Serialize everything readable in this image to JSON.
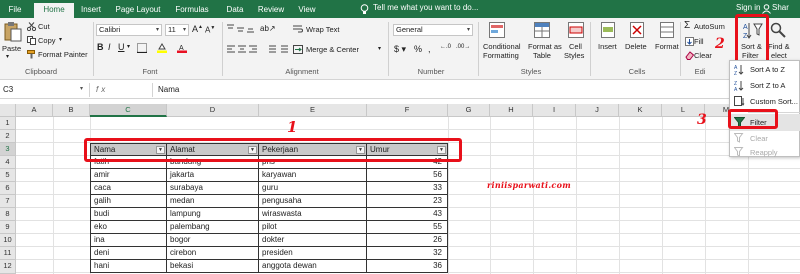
{
  "tabs": [
    "File",
    "Home",
    "Insert",
    "Page Layout",
    "Formulas",
    "Data",
    "Review",
    "View"
  ],
  "active_tab": "Home",
  "tell_me": "Tell me what you want to do...",
  "signin": "Sign in",
  "share": "Shar",
  "ribbon": {
    "clipboard": {
      "paste": "Paste",
      "cut": "Cut",
      "copy": "Copy",
      "format_painter": "Format Painter",
      "label": "Clipboard"
    },
    "font": {
      "family": "Calibri",
      "size": "11",
      "label": "Font"
    },
    "alignment": {
      "wrap_text": "Wrap Text",
      "merge_center": "Merge & Center",
      "label": "Alignment"
    },
    "number": {
      "format": "General",
      "label": "Number"
    },
    "styles": {
      "conditional": "Conditional",
      "formatting": "Formatting",
      "format_as": "Format as",
      "table": "Table",
      "cell": "Cell",
      "styles_btn": "Styles",
      "label": "Styles"
    },
    "cells": {
      "insert": "Insert",
      "delete": "Delete",
      "format": "Format",
      "label": "Cells"
    },
    "editing": {
      "autosum": "AutoSum",
      "fill": "Fill",
      "clear": "Clear",
      "sort1": "Sort &",
      "sort2": "Filter",
      "find1": "Find &",
      "find2": "elect",
      "label": "Edi"
    }
  },
  "formula_bar": {
    "name_box": "C3",
    "fx": "fx",
    "content": "Nama"
  },
  "columns": [
    "A",
    "B",
    "C",
    "D",
    "E",
    "F",
    "G",
    "H",
    "I",
    "J",
    "K",
    "L",
    "M",
    "N"
  ],
  "rows": [
    "1",
    "2",
    "3",
    "4",
    "5",
    "6",
    "7",
    "8",
    "9",
    "10",
    "11",
    "12"
  ],
  "table": {
    "headers": [
      "Nama",
      "Alamat",
      "Pekerjaan",
      "Umur"
    ],
    "rows": [
      [
        "fatih",
        "bandung",
        "pns",
        "42"
      ],
      [
        "amir",
        "jakarta",
        "karyawan",
        "56"
      ],
      [
        "caca",
        "surabaya",
        "guru",
        "33"
      ],
      [
        "galih",
        "medan",
        "pengusaha",
        "23"
      ],
      [
        "budi",
        "lampung",
        "wiraswasta",
        "43"
      ],
      [
        "eko",
        "palembang",
        "pilot",
        "55"
      ],
      [
        "ina",
        "bogor",
        "dokter",
        "26"
      ],
      [
        "deni",
        "cirebon",
        "presiden",
        "32"
      ],
      [
        "hani",
        "bekasi",
        "anggota dewan",
        "36"
      ]
    ]
  },
  "menu": {
    "sort_az": "Sort A to Z",
    "sort_za": "Sort Z to A",
    "custom_sort": "Custom Sort...",
    "filter": "Filter",
    "clear": "Clear",
    "reapply": "Reapply"
  },
  "annotations": {
    "one": "1",
    "two": "2",
    "three": "3"
  },
  "watermark": "riniisparwati.com",
  "colors": {
    "excel_green": "#217346",
    "annotation_red": "#e8101a",
    "header_fill": "#c9c9c9"
  }
}
